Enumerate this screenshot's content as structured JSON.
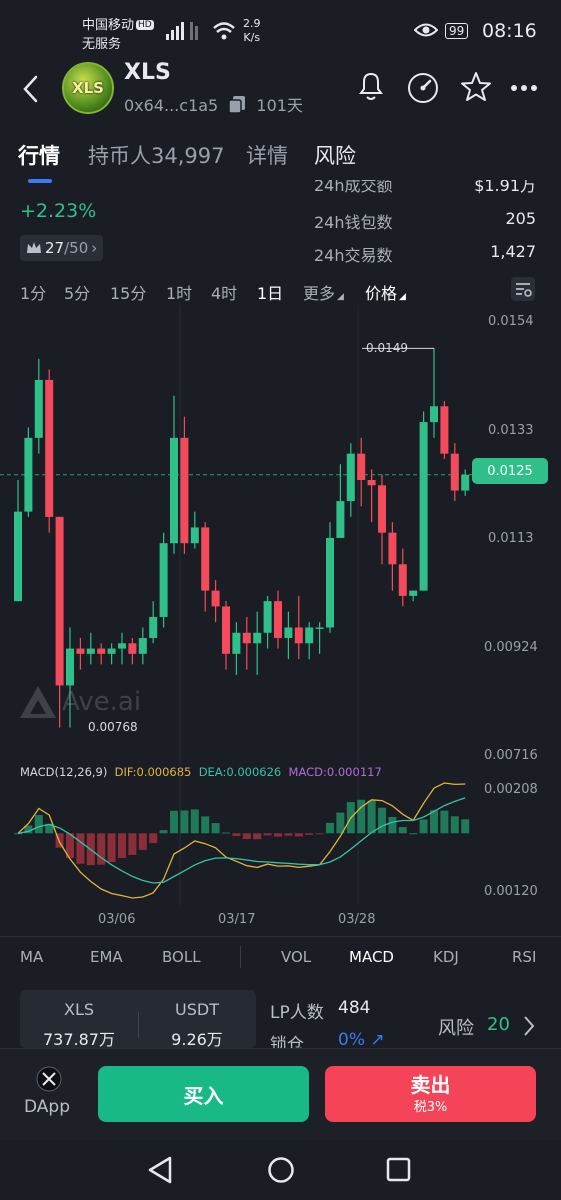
{
  "status_bar": {
    "carrier": "中国移动",
    "carrier_badge": "HD",
    "service": "无服务",
    "net_speed_value": "2.9",
    "net_speed_unit": "K/s",
    "battery": "99",
    "time": "08:16"
  },
  "header": {
    "logo_text": "XLS",
    "coin_name": "XLS",
    "address": "0x64...c1a5",
    "age": "101天"
  },
  "tabs": [
    "行情",
    "持币人34,997",
    "详情",
    "风险"
  ],
  "stats": {
    "change": "+2.23%",
    "rank": "27",
    "rank_total": "/50",
    "volume_label": "24h成交额",
    "volume_value": "$1.91万",
    "wallets_label": "24h钱包数",
    "wallets_value": "205",
    "txns_label": "24h交易数",
    "txns_value": "1,427"
  },
  "timeframes": [
    "1分",
    "5分",
    "15分",
    "1时",
    "4时",
    "1日",
    "更多",
    "价格"
  ],
  "price_axis": [
    "0.0154",
    "0.0133",
    "0.0113",
    "0.00924",
    "0.00716"
  ],
  "price_current": "0.0125",
  "price_high_label": "0.0149",
  "price_low_label": "0.00768",
  "watermark": "Ave.ai",
  "macd_legend": {
    "title": "MACD(12,26,9)",
    "dif": "DIF:0.000685",
    "dea": "DEA:0.000626",
    "macd": "MACD:0.000117"
  },
  "macd_axis": [
    "0.00208",
    "0.00120"
  ],
  "date_axis": [
    "03/06",
    "03/17",
    "03/28"
  ],
  "indicators": [
    "MA",
    "EMA",
    "BOLL",
    "VOL",
    "MACD",
    "KDJ",
    "RSI"
  ],
  "pool": {
    "token_label": "XLS",
    "token_amount": "737.87万",
    "quote_label": "USDT",
    "quote_amount": "9.26万",
    "lp_label": "LP人数",
    "lp_value": "484",
    "lock_label": "锁仓",
    "lock_value": "0%",
    "risk_label": "风险",
    "risk_value": "20"
  },
  "bottom_bar": {
    "dapp_label": "DApp",
    "buy_label": "买入",
    "sell_label": "卖出",
    "sell_tax": "税3%"
  },
  "colors": {
    "up": "#2fc08a",
    "down": "#f34b5c",
    "background": "#1b1d24",
    "accent_blue": "#3a7bf4",
    "dif_line": "#e3b43c",
    "dea_line": "#36c2a6",
    "macd_text": "#b46bd8"
  },
  "chart_data": {
    "type": "candlestick",
    "y_axis_ticks": [
      0.0154,
      0.0133,
      0.0113,
      0.00924,
      0.00716
    ],
    "ylim": [
      0.00716,
      0.0154
    ],
    "current_price": 0.0125,
    "high_marker": 0.0149,
    "low_marker": 0.00768,
    "x_tick_labels": [
      "03/06",
      "03/17",
      "03/28"
    ],
    "candles": [
      {
        "o": 0.0101,
        "c": 0.0118,
        "h": 0.0124,
        "l": 0.0101
      },
      {
        "o": 0.0118,
        "c": 0.0132,
        "h": 0.0134,
        "l": 0.0117
      },
      {
        "o": 0.0132,
        "c": 0.0143,
        "h": 0.0147,
        "l": 0.0129
      },
      {
        "o": 0.0143,
        "c": 0.0117,
        "h": 0.0145,
        "l": 0.0114
      },
      {
        "o": 0.0117,
        "c": 0.0085,
        "h": 0.0117,
        "l": 0.0077
      },
      {
        "o": 0.0085,
        "c": 0.0092,
        "h": 0.0096,
        "l": 0.0077
      },
      {
        "o": 0.0092,
        "c": 0.0091,
        "h": 0.0094,
        "l": 0.0088
      },
      {
        "o": 0.0091,
        "c": 0.0092,
        "h": 0.0095,
        "l": 0.0089
      },
      {
        "o": 0.0092,
        "c": 0.0091,
        "h": 0.0093,
        "l": 0.0089
      },
      {
        "o": 0.0091,
        "c": 0.0092,
        "h": 0.0093,
        "l": 0.0089
      },
      {
        "o": 0.0092,
        "c": 0.0093,
        "h": 0.0095,
        "l": 0.0089
      },
      {
        "o": 0.0093,
        "c": 0.0091,
        "h": 0.0094,
        "l": 0.0089
      },
      {
        "o": 0.0091,
        "c": 0.0094,
        "h": 0.0096,
        "l": 0.0089
      },
      {
        "o": 0.0094,
        "c": 0.0098,
        "h": 0.0101,
        "l": 0.0093
      },
      {
        "o": 0.0098,
        "c": 0.0112,
        "h": 0.0114,
        "l": 0.0096
      },
      {
        "o": 0.0112,
        "c": 0.0132,
        "h": 0.014,
        "l": 0.011
      },
      {
        "o": 0.0132,
        "c": 0.0112,
        "h": 0.0136,
        "l": 0.011
      },
      {
        "o": 0.0112,
        "c": 0.0115,
        "h": 0.0118,
        "l": 0.0111
      },
      {
        "o": 0.0115,
        "c": 0.0103,
        "h": 0.0116,
        "l": 0.0099
      },
      {
        "o": 0.0103,
        "c": 0.01,
        "h": 0.0105,
        "l": 0.0097
      },
      {
        "o": 0.01,
        "c": 0.0091,
        "h": 0.0101,
        "l": 0.0088
      },
      {
        "o": 0.0091,
        "c": 0.0095,
        "h": 0.0097,
        "l": 0.0087
      },
      {
        "o": 0.0095,
        "c": 0.0093,
        "h": 0.0098,
        "l": 0.0088
      },
      {
        "o": 0.0093,
        "c": 0.0095,
        "h": 0.0099,
        "l": 0.0087
      },
      {
        "o": 0.0095,
        "c": 0.0101,
        "h": 0.0102,
        "l": 0.0092
      },
      {
        "o": 0.0101,
        "c": 0.0094,
        "h": 0.0103,
        "l": 0.0092
      },
      {
        "o": 0.0094,
        "c": 0.0096,
        "h": 0.0099,
        "l": 0.009
      },
      {
        "o": 0.0096,
        "c": 0.0093,
        "h": 0.0102,
        "l": 0.009
      },
      {
        "o": 0.0093,
        "c": 0.0096,
        "h": 0.0097,
        "l": 0.009
      },
      {
        "o": 0.0096,
        "c": 0.0096,
        "h": 0.0097,
        "l": 0.0091
      },
      {
        "o": 0.0096,
        "c": 0.0113,
        "h": 0.0116,
        "l": 0.0095
      },
      {
        "o": 0.0113,
        "c": 0.012,
        "h": 0.0127,
        "l": 0.0113
      },
      {
        "o": 0.012,
        "c": 0.0129,
        "h": 0.0131,
        "l": 0.0117
      },
      {
        "o": 0.0129,
        "c": 0.0124,
        "h": 0.0132,
        "l": 0.0119
      },
      {
        "o": 0.0124,
        "c": 0.0123,
        "h": 0.0126,
        "l": 0.0116
      },
      {
        "o": 0.0123,
        "c": 0.0114,
        "h": 0.0125,
        "l": 0.0108
      },
      {
        "o": 0.0114,
        "c": 0.0108,
        "h": 0.0116,
        "l": 0.0103
      },
      {
        "o": 0.0108,
        "c": 0.0102,
        "h": 0.0111,
        "l": 0.01
      },
      {
        "o": 0.0102,
        "c": 0.0103,
        "h": 0.0103,
        "l": 0.0101
      },
      {
        "o": 0.0103,
        "c": 0.0135,
        "h": 0.0137,
        "l": 0.0103
      },
      {
        "o": 0.0135,
        "c": 0.0138,
        "h": 0.0149,
        "l": 0.0132
      },
      {
        "o": 0.0138,
        "c": 0.0129,
        "h": 0.0139,
        "l": 0.0128
      },
      {
        "o": 0.0129,
        "c": 0.0122,
        "h": 0.0131,
        "l": 0.012
      },
      {
        "o": 0.0122,
        "c": 0.0125,
        "h": 0.0126,
        "l": 0.0121
      }
    ]
  }
}
